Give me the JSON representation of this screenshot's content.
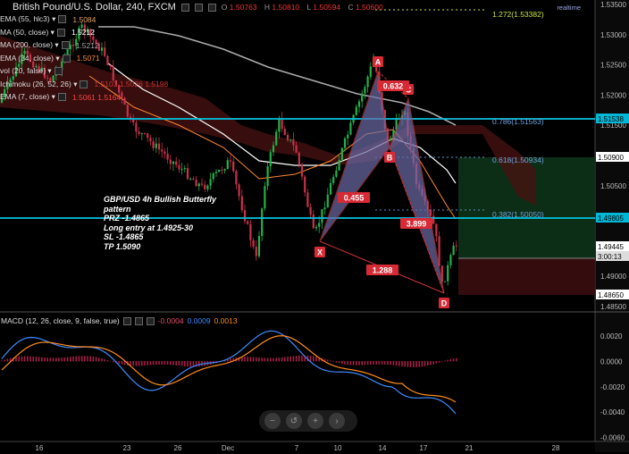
{
  "header": {
    "title": "British Pound/U.S. Dollar, 240, FXCM",
    "ohlc": [
      {
        "label": "O",
        "value": "1.50763"
      },
      {
        "label": "H",
        "value": "1.50810"
      },
      {
        "label": "L",
        "value": "1.50594"
      },
      {
        "label": "C",
        "value": "1.50600"
      }
    ],
    "realtime": "realtime"
  },
  "indicators": [
    {
      "name": "EMA (55, hlc3)",
      "value": "1.5084",
      "color": "#e0a060"
    },
    {
      "name": "MA (50, close)",
      "value": "1.5212",
      "color": "#ffffff"
    },
    {
      "name": "MA (200, close)",
      "value": "1.5212",
      "color": "#aaaaaa"
    },
    {
      "name": "EMA (34, close)",
      "value": "1.5071",
      "color": "#ff8833"
    },
    {
      "name": "vol (20, false)",
      "value": "",
      "color": "#888888"
    },
    {
      "name": "Ichimoku (26, 52, 26)",
      "value": "1.5103 1.5026 1.5198",
      "color": "#cc3333"
    },
    {
      "name": "EMA (7, close)",
      "value": "1.5061 1.5164",
      "color": "#ff4444"
    }
  ],
  "note": [
    "GBP/USD 4h Bullish Butterfly",
    "pattern",
    "PRZ -1.4865",
    "Long entry at 1.4925-30",
    "SL -1.4865",
    "TP 1.5090"
  ],
  "pattern_labels": {
    "X": "X",
    "A": "A",
    "B": "B",
    "C": "C",
    "D": "D",
    "xa_b": "0.455",
    "ab_c": "0.632",
    "bc_d": "3.899",
    "xa_d": "1.288"
  },
  "fib_labels": [
    "1.272(1.53382)",
    "0.786(1.51563)",
    "0.618(1.50934)",
    "0.382(1.50050)"
  ],
  "price_axis": {
    "ticks": [
      "1.53500",
      "1.53000",
      "1.52500",
      "1.52000",
      "1.51500",
      "1.51000",
      "1.50500",
      "1.50000",
      "1.49500",
      "1.49000",
      "1.48500"
    ],
    "tags": [
      {
        "label": "1.51538",
        "color": "#00b7d6",
        "text": "#000000"
      },
      {
        "label": "1.50900",
        "color": "#ffffff",
        "text": "#000000"
      },
      {
        "label": "1.49805",
        "color": "#00b7d6",
        "text": "#000000"
      },
      {
        "label": "1.49445",
        "color": "#ffffff",
        "text": "#000000"
      },
      {
        "label": "3:00:13",
        "color": "#dddddd",
        "text": "#000000"
      },
      {
        "label": "1.48650",
        "color": "#ffffff",
        "text": "#000000"
      }
    ]
  },
  "time_axis": [
    "16",
    "23",
    "26",
    "Dec",
    "7",
    "10",
    "14",
    "17",
    "21",
    "28"
  ],
  "macd": {
    "title": "MACD (12, 26, close, 9, false, true)",
    "values": [
      {
        "v": "-0.0004",
        "color": "#e74c6b"
      },
      {
        "v": "0.0009",
        "color": "#3d8bff"
      },
      {
        "v": "0.0013",
        "color": "#ff8c1a"
      }
    ],
    "ticks": [
      "0.0020",
      "0.0000",
      "-0.0020",
      "-0.0040",
      "-0.0060"
    ]
  },
  "controls": [
    "zoom-out",
    "reset",
    "zoom-in",
    "scroll-right"
  ],
  "colors": {
    "bull": "#22b14c",
    "bear": "#c8324a",
    "cyan_line": "#00c4e0",
    "pattern_fill": "#6c6ca8",
    "target_zone": "#0f3d1a",
    "stop_zone": "#3d0f12"
  }
}
